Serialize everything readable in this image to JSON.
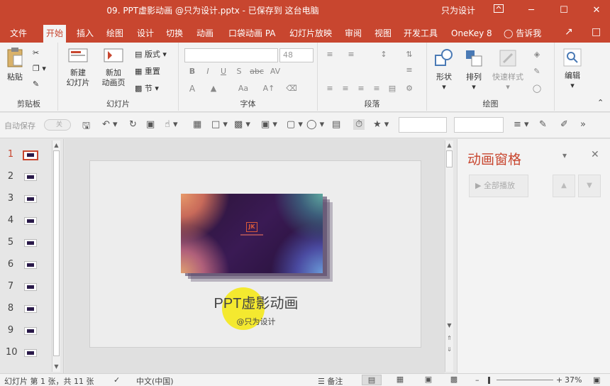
{
  "titlebar": {
    "title": "09. PPT虚影动画 @只为设计.pptx  -  已保存到 这台电脑",
    "user": "只为设计",
    "restore_icon": "ribbon-display-icon",
    "minimize": "─",
    "maximize": "☐",
    "close": "✕"
  },
  "tabs": [
    "文件",
    "开始",
    "插入",
    "绘图",
    "设计",
    "切换",
    "动画",
    "口袋动画 PA",
    "幻灯片放映",
    "审阅",
    "视图",
    "开发工具",
    "OneKey 8",
    "告诉我"
  ],
  "active_tab": "开始",
  "ribbon": {
    "clipboard": {
      "label": "剪贴板",
      "paste": "粘贴"
    },
    "slides": {
      "label": "幻灯片",
      "new_slide": "新建\n幻灯片",
      "new_anim_page": "新加\n动画页",
      "layout": "版式",
      "reset": "重置",
      "section": "节"
    },
    "font": {
      "label": "字体",
      "font_name": "",
      "font_size": "48",
      "bold": "B",
      "italic": "I",
      "underline": "U",
      "shadow": "S",
      "strike": "abc",
      "spacing": "AV",
      "case": "Aa",
      "color": "A"
    },
    "paragraph": {
      "label": "段落"
    },
    "drawing": {
      "label": "绘图",
      "shape": "形状",
      "arrange": "排列",
      "quick_style": "快速样式"
    },
    "editing": {
      "label": "编辑"
    }
  },
  "qat": {
    "autosave": "自动保存",
    "toggle": "关"
  },
  "thumbnails": [
    {
      "num": "1",
      "selected": true
    },
    {
      "num": "2",
      "selected": false
    },
    {
      "num": "3",
      "selected": false
    },
    {
      "num": "4",
      "selected": false
    },
    {
      "num": "5",
      "selected": false
    },
    {
      "num": "6",
      "selected": false
    },
    {
      "num": "7",
      "selected": false
    },
    {
      "num": "8",
      "selected": false
    },
    {
      "num": "9",
      "selected": false
    },
    {
      "num": "10",
      "selected": false
    }
  ],
  "slide": {
    "title": "PPT虚影动画",
    "subtitle": "@只为设计",
    "logo": "JK"
  },
  "anim_pane": {
    "title": "动画窗格",
    "play_all": "全部播放",
    "up": "▲",
    "down": "▼"
  },
  "status": {
    "slide_info": "幻灯片 第 1 张，共 11 张",
    "language": "中文(中国)",
    "notes": "备注",
    "zoom": "37%"
  },
  "colors": {
    "accent": "#c8462f",
    "ribbon_bg": "#f3f3f3",
    "canvas_bg": "#e0e0e0"
  }
}
